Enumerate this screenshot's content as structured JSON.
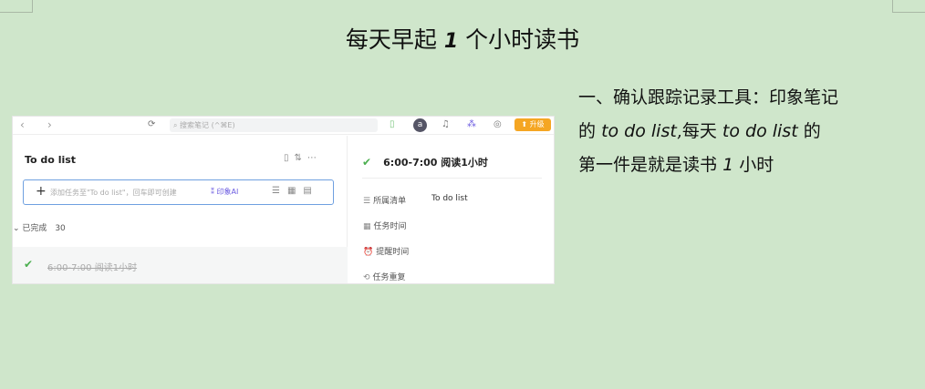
{
  "document": {
    "title_before": "每天早起",
    "title_number": "1",
    "title_after": "个小时读书",
    "side_text": {
      "line1": "一、确认跟踪记录工具：印象笔记",
      "p_de": "的",
      "p_todo1": "to do list",
      "p_comma": ",每天",
      "p_todo2": "to  do list",
      "p_de2": "的",
      "line3_a": "第一件是就是读书",
      "line3_num": "1",
      "line3_b": "小时"
    }
  },
  "app": {
    "search_placeholder": "搜索笔记 (^⌘E)",
    "avatar_letter": "a",
    "upgrade_label": "升级",
    "list_title": "To do list",
    "add_placeholder": "添加任务至\"To do list\"，回车即可创建",
    "ai_label": "印象AI",
    "completed_label": "已完成",
    "completed_count": "30",
    "completed_task": "6:00-7:00 阅读1小时",
    "detail_title": "6:00-7:00 阅读1小时",
    "props": [
      {
        "label": "所属清单",
        "value": "To do list"
      },
      {
        "label": "任务时间",
        "value": ""
      },
      {
        "label": "提醒时间",
        "value": ""
      },
      {
        "label": "任务重复",
        "value": ""
      }
    ]
  }
}
